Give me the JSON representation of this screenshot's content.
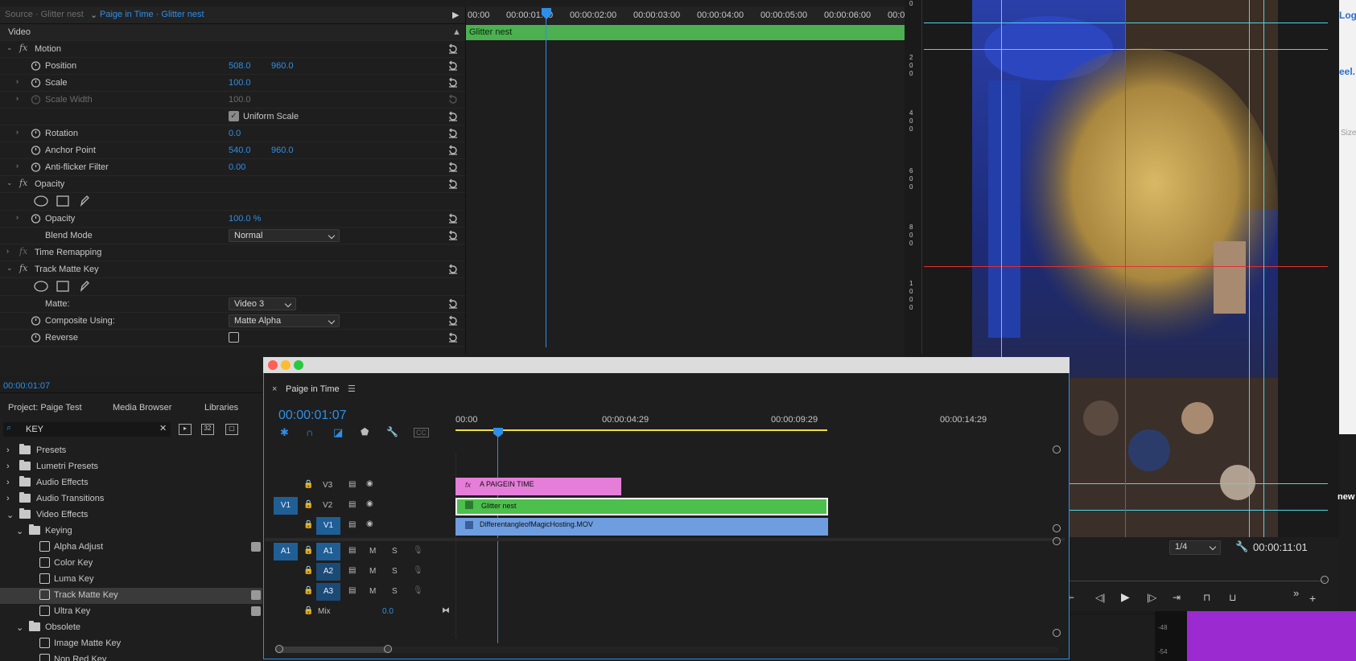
{
  "effect_controls": {
    "tab_source": "Source · Glitter nest",
    "tab_active": "Paige in Time · Glitter nest",
    "section_video": "Video",
    "motion": "Motion",
    "position_label": "Position",
    "position_x": "508.0",
    "position_y": "960.0",
    "scale_label": "Scale",
    "scale_value": "100.0",
    "scale_width_label": "Scale Width",
    "scale_width_value": "100.0",
    "uniform_scale_label": "Uniform Scale",
    "rotation_label": "Rotation",
    "rotation_value": "0.0",
    "anchor_label": "Anchor Point",
    "anchor_x": "540.0",
    "anchor_y": "960.0",
    "antiflicker_label": "Anti-flicker Filter",
    "antiflicker_value": "0.00",
    "opacity_section": "Opacity",
    "opacity_label": "Opacity",
    "opacity_value": "100.0 %",
    "blend_label": "Blend Mode",
    "blend_value": "Normal",
    "time_remap": "Time Remapping",
    "track_matte": "Track Matte Key",
    "matte_label": "Matte:",
    "matte_value": "Video 3",
    "composite_label": "Composite Using:",
    "composite_value": "Matte Alpha",
    "reverse_label": "Reverse",
    "current_time": "00:00:01:07",
    "mini_clip": "Glitter nest",
    "ruler": [
      "00:00",
      "00:00:01:00",
      "00:00:02:00",
      "00:00:03:00",
      "00:00:04:00",
      "00:00:05:00",
      "00:00:06:00",
      "00:00:0"
    ]
  },
  "program": {
    "fraction": "1/4",
    "duration": "00:00:11:01",
    "scale_ticks": [
      "0",
      "2",
      "0",
      "0",
      "4",
      "0",
      "0",
      "6",
      "0",
      "0",
      "8",
      "0",
      "0",
      "1",
      "0",
      "0",
      "0"
    ],
    "right_fragments": [
      "Log",
      "eel.",
      "Size",
      "new"
    ],
    "meter_labels": [
      "-48",
      "-54"
    ]
  },
  "project": {
    "tab_project": "Project: Paige Test",
    "tab_media": "Media Browser",
    "tab_libraries": "Libraries",
    "search_value": "KEY",
    "items": [
      {
        "label": "Presets",
        "level": 0,
        "kind": "folder"
      },
      {
        "label": "Lumetri Presets",
        "level": 0,
        "kind": "folder"
      },
      {
        "label": "Audio Effects",
        "level": 0,
        "kind": "folder"
      },
      {
        "label": "Audio Transitions",
        "level": 0,
        "kind": "folder"
      },
      {
        "label": "Video Effects",
        "level": 0,
        "kind": "folder"
      },
      {
        "label": "Keying",
        "level": 1,
        "kind": "folder"
      },
      {
        "label": "Alpha Adjust",
        "level": 2,
        "kind": "fx"
      },
      {
        "label": "Color Key",
        "level": 2,
        "kind": "fx"
      },
      {
        "label": "Luma Key",
        "level": 2,
        "kind": "fx"
      },
      {
        "label": "Track Matte Key",
        "level": 2,
        "kind": "fx"
      },
      {
        "label": "Ultra Key",
        "level": 2,
        "kind": "fx"
      },
      {
        "label": "Obsolete",
        "level": 1,
        "kind": "folder"
      },
      {
        "label": "Image Matte Key",
        "level": 2,
        "kind": "fx"
      },
      {
        "label": "Non Red Key",
        "level": 2,
        "kind": "fx"
      }
    ]
  },
  "timeline": {
    "seq_name": "Paige in Time",
    "timecode": "00:00:01:07",
    "ruler": [
      "00:00",
      "00:00:04:29",
      "00:00:09:29",
      "00:00:14:29"
    ],
    "tracks": {
      "v3": "V3",
      "v2": "V2",
      "v1": "V1",
      "v1_src": "V1",
      "a1": "A1",
      "a1_src": "A1",
      "a2": "A2",
      "a3": "A3",
      "m": "M",
      "s": "S",
      "mix": "Mix",
      "mix_value": "0.0"
    },
    "clips": {
      "title": "A PAIGEIN TIME",
      "glitter": "Glitter nest",
      "video": "DifferentangleofMagicHosting.MOV"
    }
  }
}
